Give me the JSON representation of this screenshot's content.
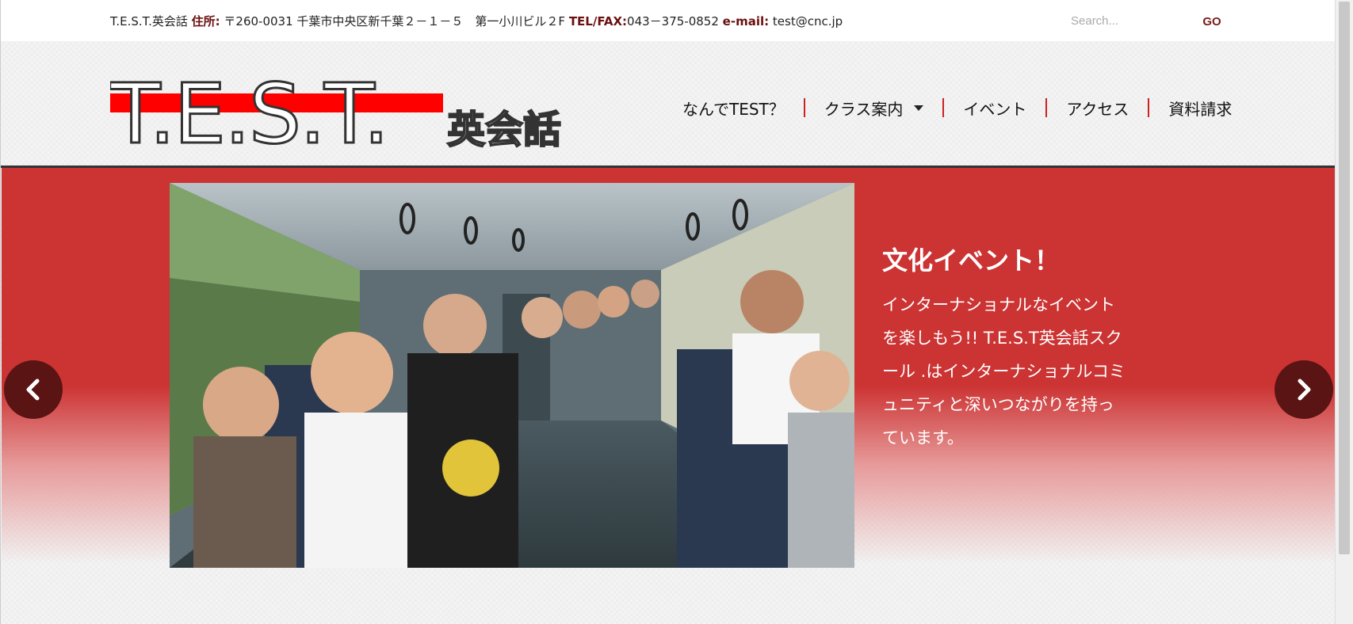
{
  "topbar": {
    "school": "T.E.S.T.英会話",
    "address_label": "住所:",
    "address": "〒260-0031 千葉市中央区新千葉２－１－５　第一小川ビル２F",
    "tel_label": "TEL/FAX:",
    "tel": "043－375-0852",
    "email_label": "e-mail:",
    "email": "test@cnc.jp",
    "search_placeholder": "Search...",
    "go_label": "GO"
  },
  "logo": {
    "main": "T.E.S.T.",
    "sub": "英会話"
  },
  "nav": {
    "items": [
      {
        "label": "なんでTEST？"
      },
      {
        "label": "クラス案内",
        "has_dropdown": true
      },
      {
        "label": "イベント"
      },
      {
        "label": "アクセス"
      },
      {
        "label": "資料請求"
      }
    ]
  },
  "slide": {
    "title": "文化イベント！",
    "body": "インターナショナルなイベントを楽しもう!! T.E.S.T英会話スクール .はインターナショナルコミュニティと深いつながりを持っています。",
    "prev_icon": "chevron-left-icon",
    "next_icon": "chevron-right-icon"
  },
  "colors": {
    "accent_red": "#cc3333",
    "arrow_bg": "#5a1414",
    "nav_separator": "#cc2222"
  }
}
